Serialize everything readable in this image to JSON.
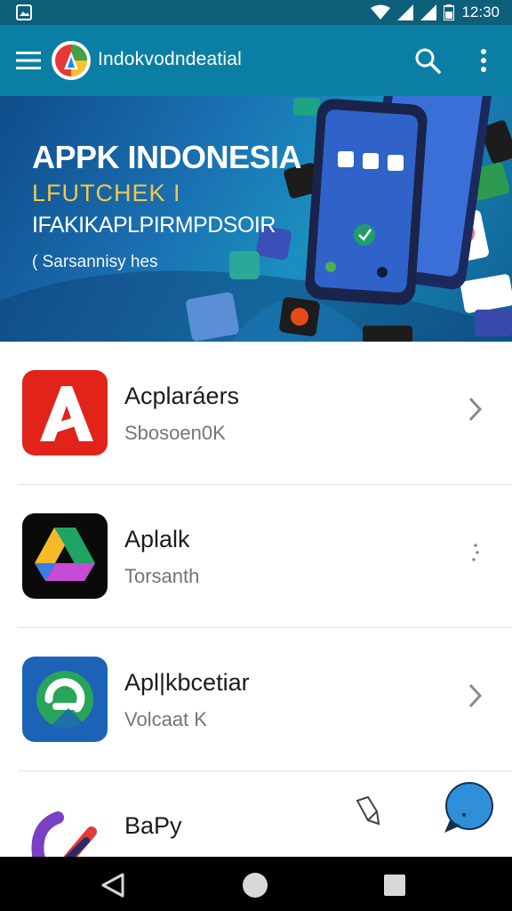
{
  "status_bar": {
    "time": "12:30"
  },
  "app_bar": {
    "title": "Indokvodndeatial"
  },
  "banner": {
    "title": "APPK INDONESIA",
    "line2": "LFUTCHEK I",
    "line3": "IFAKIKAPLPIRMPDSOIR",
    "line4": "( Sarsannisy hes"
  },
  "apps": [
    {
      "name": "Acplaráers",
      "subtitle": "Sbosoen0K",
      "icon": "red-letter-a-icon"
    },
    {
      "name": "Aplalk",
      "subtitle": "Torsanth",
      "icon": "triangle-drive-icon"
    },
    {
      "name": "Apl|kbcetiar",
      "subtitle": "Volcaat K",
      "icon": "green-circle-icon"
    },
    {
      "name": "BaPy",
      "subtitle": "",
      "icon": "purple-swirl-icon"
    }
  ],
  "colors": {
    "app_bar": "#0b7fa3",
    "status_bar": "#0d5f7a",
    "chat_fab": "#2f8fd8"
  }
}
